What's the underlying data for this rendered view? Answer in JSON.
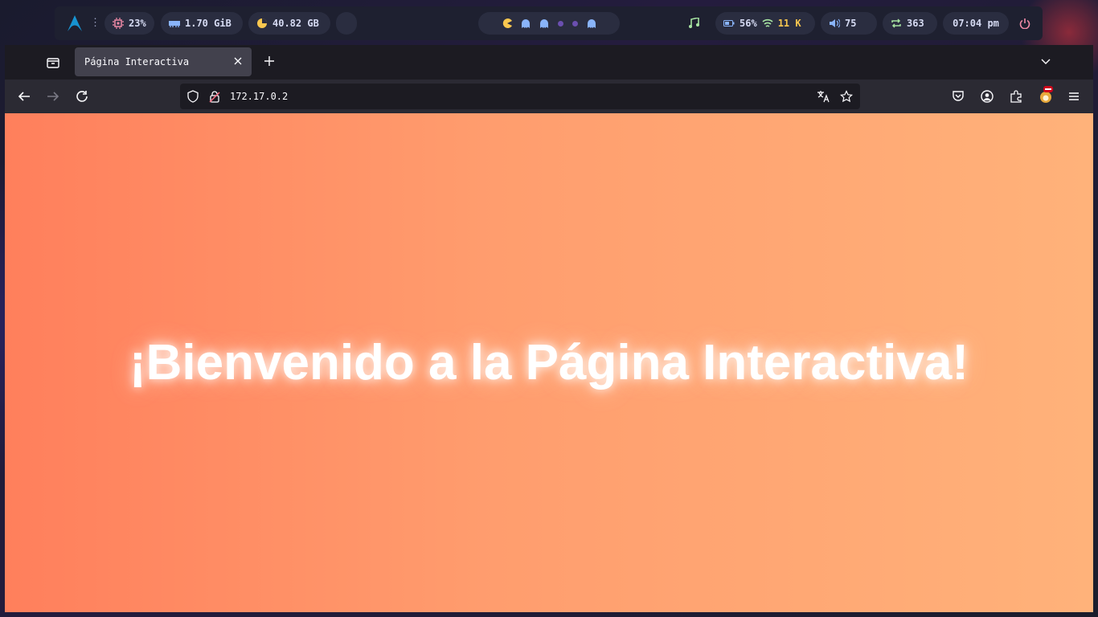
{
  "topbar": {
    "cpu": "23%",
    "memory": "1.70 GiB",
    "disk": "40.82 GB",
    "battery": "56%",
    "wifi": "11 K",
    "volume": "75",
    "updates": "363",
    "clock": "07:04 pm"
  },
  "browser": {
    "tab_title": "Página Interactiva",
    "url": "172.17.0.2"
  },
  "page": {
    "heading": "¡Bienvenido a la Página Interactiva!"
  },
  "colors": {
    "gradient_start": "#ff7f5c",
    "gradient_end": "#ffb27a",
    "heading": "#ffffff"
  }
}
